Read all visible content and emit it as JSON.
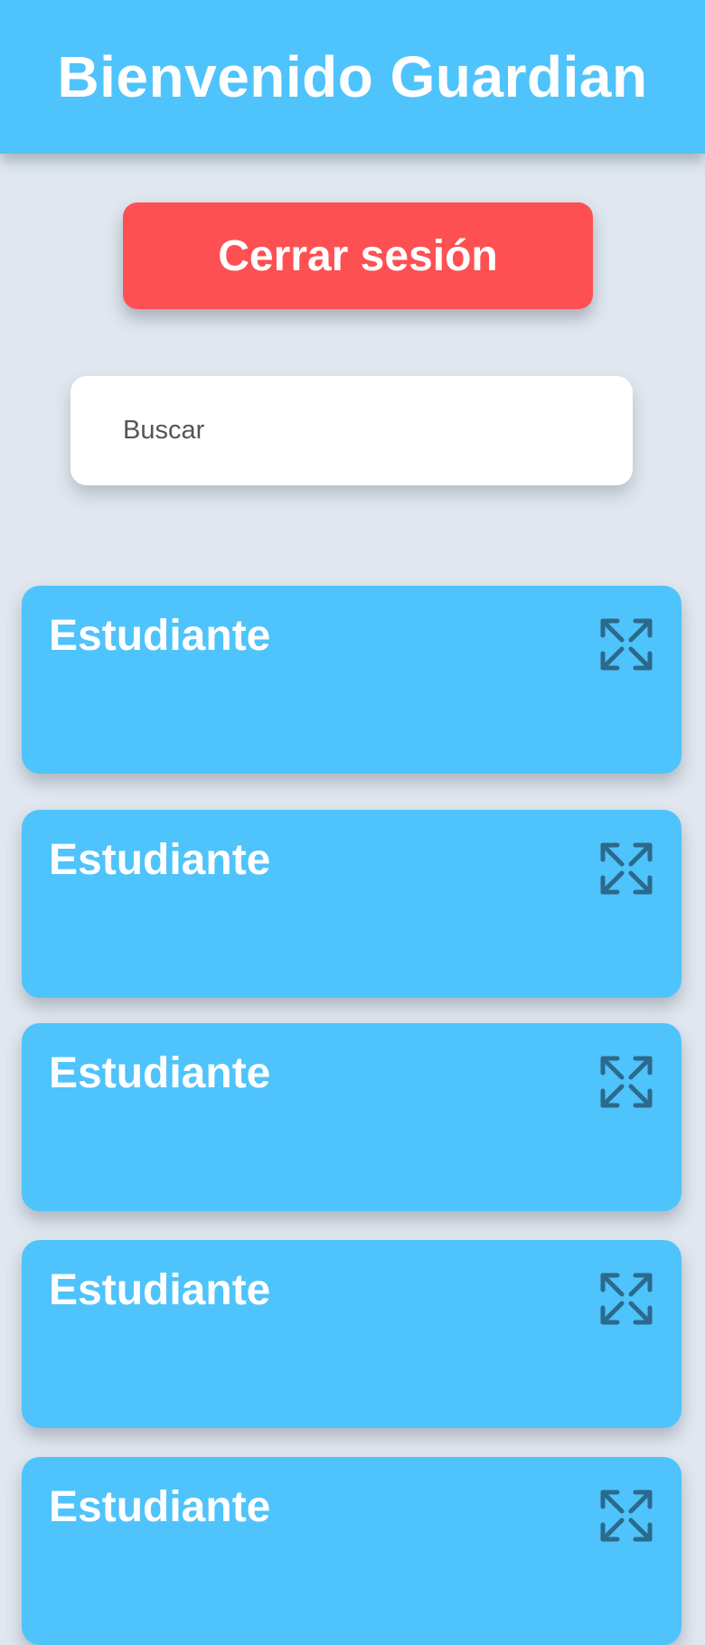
{
  "header": {
    "title": "Bienvenido Guardian"
  },
  "actions": {
    "logout_label": "Cerrar sesión"
  },
  "search": {
    "placeholder": "Buscar",
    "value": ""
  },
  "students": [
    {
      "label": "Estudiante",
      "icon": "expand-icon"
    },
    {
      "label": "Estudiante",
      "icon": "expand-icon"
    },
    {
      "label": "Estudiante",
      "icon": "expand-icon"
    },
    {
      "label": "Estudiante",
      "icon": "expand-icon"
    },
    {
      "label": "Estudiante",
      "icon": "expand-icon"
    }
  ],
  "colors": {
    "primary": "#4fc3fb",
    "danger": "#fe5052",
    "background": "#e0e7ef",
    "icon": "#2b6a8c"
  }
}
